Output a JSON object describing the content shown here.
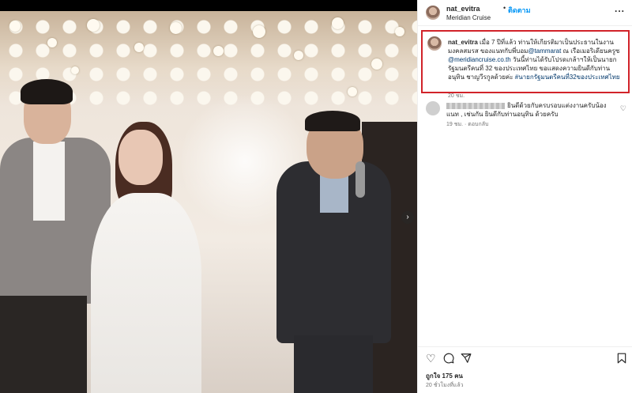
{
  "header": {
    "username": "nat_evitra",
    "dot": "•",
    "follow_label": "ติดตาม",
    "location": "Meridian Cruise",
    "more": "..."
  },
  "caption": {
    "username": "nat_evitra",
    "text_1": " เมื่อ 7 ปีที่แล้ว ท่านให้เกียรติมาเป็นประธานในงานมงคลสมรส ของแนทกับพี่บอม",
    "mention_1": "@tammarat",
    "text_2": " ณ เรือเมอริเดียนครูซ ",
    "mention_2": "@meridiancruise.co.th",
    "text_3": " วันนี้ท่านได้รับโปรดเกล้าฯให้เป็นนายกรัฐมนตรีคนที่ 32 ของประเทศไทย ขอแสดงความยินดีกับท่านอนุทิน ชาญวีรกูลด้วยค่ะ ",
    "hashtag": "#นายกรัฐมนตรีคนที่32ของประเทศไทย",
    "time": "20 ชม."
  },
  "comment": {
    "text": "ยินดีด้วยกับครบรอบแต่งงานครับน้องแนท , เช่นกัน ยินดีกับท่านอนุทิน ด้วยครับ",
    "time": "19 ชม.",
    "reply_label": "ตอบกลับ"
  },
  "actions": {
    "likes": "ถูกใจ 175 คน",
    "post_time": "20 ชั่วโมงที่แล้ว"
  },
  "icons": [
    "heart-icon",
    "comment-icon",
    "share-icon",
    "bookmark-icon",
    "next-arrow-icon",
    "more-icon"
  ]
}
